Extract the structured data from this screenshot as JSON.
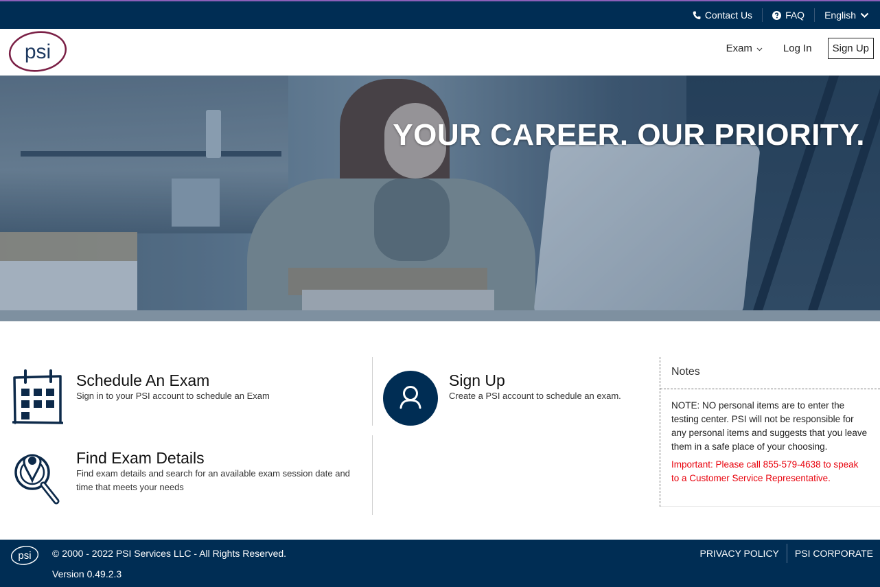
{
  "topbar": {
    "contact": {
      "label": "Contact Us",
      "icon": "phone-icon"
    },
    "faq": {
      "label": "FAQ",
      "icon": "question-circle-icon"
    },
    "language": {
      "label": "English",
      "icon": "chevron-down-icon"
    }
  },
  "navbar": {
    "logo_text": "psi",
    "exam_menu": "Exam",
    "login": "Log In",
    "signup": "Sign Up"
  },
  "hero": {
    "headline": "YOUR CAREER. OUR PRIORITY."
  },
  "cards": [
    {
      "title": "Schedule An Exam",
      "description": "Sign in to your PSI account to schedule an Exam",
      "icon": "calendar-icon"
    },
    {
      "title": "Sign Up",
      "description": "Create a PSI account to schedule an exam.",
      "icon": "user-icon"
    },
    {
      "title": "Find Exam Details",
      "description": "Find exam details and search for an available exam session date and time that meets your needs",
      "icon": "location-search-icon"
    }
  ],
  "notes": {
    "title": "Notes",
    "body": "NOTE: NO personal items are to enter the testing center. PSI will not be responsible for any personal items and suggests that you leave them in a safe place of your choosing.",
    "important": "Important: Please call 855-579-4638 to speak to a Customer Service Representative."
  },
  "footer": {
    "logo_text": "psi",
    "copyright": "© 2000 - 2022 PSI Services LLC - All Rights Reserved.",
    "version": "Version 0.49.2.3",
    "links": [
      "PRIVACY POLICY",
      "PSI CORPORATE"
    ]
  },
  "colors": {
    "brand_navy": "#002d54",
    "logo_maroon": "#7a1f45",
    "accent_purple": "#8b5fb8",
    "important_red": "#e8000b"
  }
}
